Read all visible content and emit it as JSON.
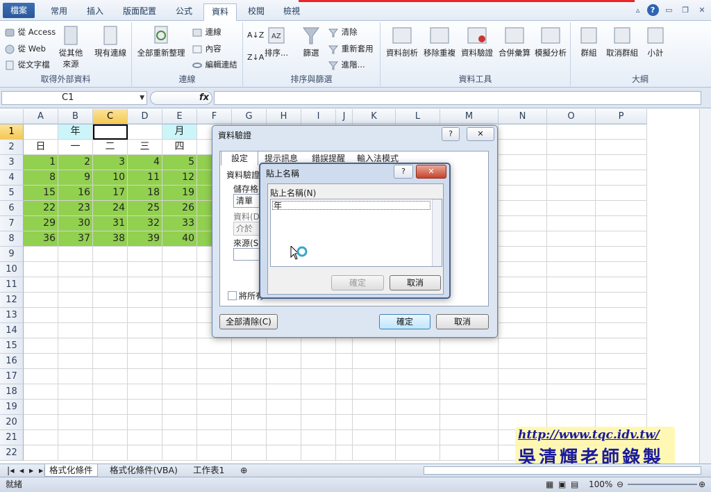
{
  "tabs": [
    "檔案",
    "常用",
    "插入",
    "版面配置",
    "公式",
    "資料",
    "校閱",
    "檢視"
  ],
  "ribbon": {
    "external": {
      "access": "從 Access",
      "web": "從 Web",
      "text": "從文字檔",
      "other": "從其他",
      "other2": "來源",
      "existing": "現有連線",
      "label": "取得外部資料"
    },
    "connections": {
      "refresh": "全部重新整理",
      "conn": "連線",
      "props": "內容",
      "edit": "編輯連結",
      "label": "連線"
    },
    "sort": {
      "az": "A↓Z",
      "za": "Z↓A",
      "sort": "排序...",
      "filter": "篩選",
      "clear": "清除",
      "reapply": "重新套用",
      "advanced": "進階...",
      "label": "排序與篩選"
    },
    "tools": {
      "split": "資料剖析",
      "dup": "移除重複",
      "valid": "資料驗證",
      "consol": "合併彙算",
      "whatif": "模擬分析",
      "label": "資料工具"
    },
    "outline": {
      "group": "群組",
      "ungroup": "取消群組",
      "subtotal": "小計",
      "label": "大綱"
    }
  },
  "namebox": "C1",
  "fx": "fx",
  "columns": [
    "A",
    "B",
    "C",
    "D",
    "E",
    "F",
    "G",
    "H",
    "I",
    "J",
    "K",
    "L",
    "M",
    "N",
    "O",
    "P"
  ],
  "rows": [
    "1",
    "2",
    "3",
    "4",
    "5",
    "6",
    "7",
    "8",
    "9",
    "10",
    "11",
    "12",
    "13",
    "14",
    "15",
    "16",
    "17",
    "18",
    "19",
    "20",
    "21",
    "22"
  ],
  "cells": {
    "b1": "年",
    "e1": "月",
    "weekdays": [
      "日",
      "一",
      "二",
      "三",
      "四"
    ],
    "data": [
      [
        "1",
        "2",
        "3",
        "4",
        "5"
      ],
      [
        "8",
        "9",
        "10",
        "11",
        "12"
      ],
      [
        "15",
        "16",
        "17",
        "18",
        "19"
      ],
      [
        "22",
        "23",
        "24",
        "25",
        "26"
      ],
      [
        "29",
        "30",
        "31",
        "32",
        "33"
      ],
      [
        "36",
        "37",
        "38",
        "39",
        "40"
      ]
    ]
  },
  "sheets": [
    "格式化條件",
    "格式化條件(VBA)",
    "工作表1"
  ],
  "status": {
    "ready": "就緒",
    "zoom": "100%"
  },
  "validation": {
    "title": "資料驗證",
    "tabs": [
      "設定",
      "提示訊息",
      "錯誤提醒",
      "輸入法模式"
    ],
    "criteria": "資料驗證",
    "allow": "儲存格",
    "allow_value": "清單",
    "data": "資料(D)",
    "data_value": "介於",
    "source": "來源(S)",
    "apply": "將所有",
    "clear_all": "全部清除(C)",
    "ok": "確定",
    "cancel": "取消"
  },
  "paste": {
    "title": "貼上名稱",
    "label": "貼上名稱(N)",
    "item": "年",
    "ok": "確定",
    "cancel": "取消"
  },
  "watermark": {
    "url": "http://www.tqc.idv.tw/",
    "name": "吳清輝老師錄製"
  },
  "colors": {
    "green": "#92d050",
    "cyan": "#ccf5fa",
    "file_tab": "#2a579a"
  }
}
